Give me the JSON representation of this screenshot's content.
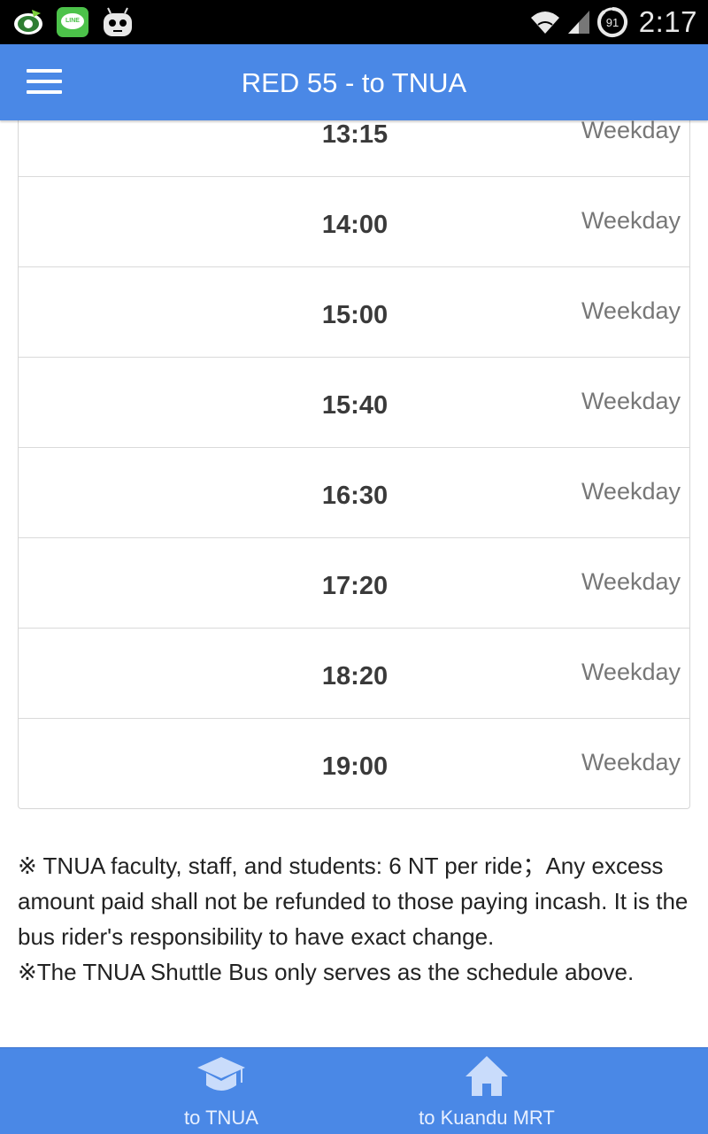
{
  "status_bar": {
    "time": "2:17",
    "notification_count": "91",
    "line_app_label": "LINE"
  },
  "app_bar": {
    "title": "RED 55 - to TNUA",
    "menu_icon": "hamburger-menu-icon"
  },
  "schedule": [
    {
      "time": "13:15",
      "day": "Weekday"
    },
    {
      "time": "14:00",
      "day": "Weekday"
    },
    {
      "time": "15:00",
      "day": "Weekday"
    },
    {
      "time": "15:40",
      "day": "Weekday"
    },
    {
      "time": "16:30",
      "day": "Weekday"
    },
    {
      "time": "17:20",
      "day": "Weekday"
    },
    {
      "time": "18:20",
      "day": "Weekday"
    },
    {
      "time": "19:00",
      "day": "Weekday"
    }
  ],
  "notes": {
    "line1": "※ TNUA faculty, staff, and students: 6 NT per ride；Any excess amount paid shall not be refunded to those paying incash. It is the bus rider's responsibility to have exact change.",
    "line2": "※The TNUA Shuttle Bus only serves as the schedule above."
  },
  "bottom_nav": [
    {
      "label": "to TNUA",
      "icon": "graduation-cap-icon"
    },
    {
      "label": "to Kuandu MRT",
      "icon": "home-icon"
    }
  ],
  "colors": {
    "primary": "#4a88e6",
    "status_bar": "#000000",
    "time_text": "#3a3a3a",
    "day_text": "#777777"
  }
}
